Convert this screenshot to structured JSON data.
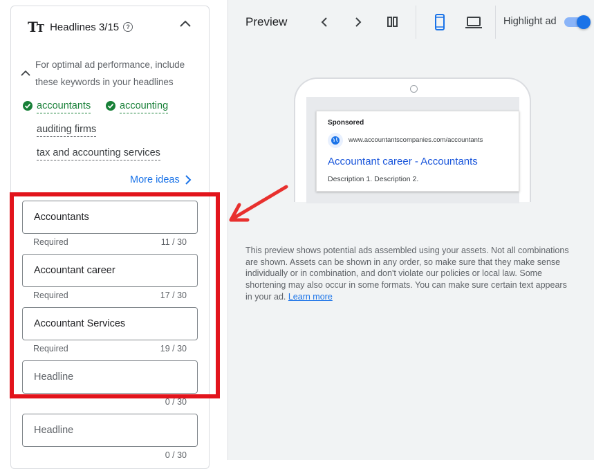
{
  "headlines": {
    "title": "Headlines 3/15",
    "tip": "For optimal ad performance, include these keywords in your headlines",
    "keywords": [
      {
        "text": "accountants",
        "done": true
      },
      {
        "text": "accounting",
        "done": true
      },
      {
        "text": "auditing firms",
        "done": false
      },
      {
        "text": "tax and accounting services",
        "done": false
      }
    ],
    "more_ideas": "More ideas",
    "fields": [
      {
        "value": "Accountants",
        "meta_label": "Required",
        "count": "11 / 30"
      },
      {
        "value": "Accountant career",
        "meta_label": "Required",
        "count": "17 / 30"
      },
      {
        "value": "Accountant Services",
        "meta_label": "Required",
        "count": "19 / 30"
      },
      {
        "placeholder": "Headline",
        "meta_label": "",
        "count": "0 / 30"
      },
      {
        "placeholder": "Headline",
        "meta_label": "",
        "count": "0 / 30"
      }
    ]
  },
  "preview": {
    "title": "Preview",
    "highlight_label": "Highlight ad",
    "highlight_on": true,
    "ad": {
      "sponsored": "Sponsored",
      "url": "www.accountantscompanies.com/accountants",
      "headline": "Accountant career - Accountants",
      "description": "Description 1. Description 2."
    },
    "disclaimer": "This preview shows potential ads assembled using your assets. Not all combinations are shown. Assets can be shown in any order, so make sure that they make sense individually or in combination, and don't violate our policies or local law. Some shortening may also occur in some formats. You can make sure certain text appears in your ad.",
    "learn_more": "Learn more"
  },
  "colors": {
    "accent": "#1a73e8",
    "check_green": "#188038",
    "annotation_red": "#e2141c"
  }
}
